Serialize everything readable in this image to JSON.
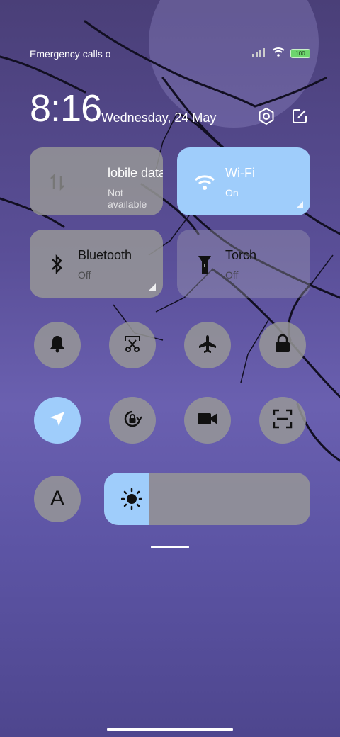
{
  "status": {
    "left_text": "Emergency calls o",
    "battery": "100"
  },
  "header": {
    "time": "8:16",
    "date": "Wednesday, 24 May"
  },
  "tiles": [
    {
      "title": "lobile data",
      "subtitle": "Not available",
      "icon": "data-arrows-icon",
      "state": "unavailable"
    },
    {
      "title": "Wi-Fi",
      "subtitle": "On",
      "icon": "wifi-icon",
      "state": "on"
    },
    {
      "title": "Bluetooth",
      "subtitle": "Off",
      "icon": "bluetooth-icon",
      "state": "off"
    },
    {
      "title": "Torch",
      "subtitle": "Off",
      "icon": "torch-icon",
      "state": "off"
    }
  ],
  "toggles_row1": [
    {
      "icon": "bell-icon",
      "state": "off"
    },
    {
      "icon": "screenshot-icon",
      "state": "off"
    },
    {
      "icon": "airplane-icon",
      "state": "off"
    },
    {
      "icon": "lock-icon",
      "state": "off"
    }
  ],
  "toggles_row2": [
    {
      "icon": "location-icon",
      "state": "on"
    },
    {
      "icon": "rotation-lock-icon",
      "state": "off"
    },
    {
      "icon": "video-camera-icon",
      "state": "off"
    },
    {
      "icon": "scan-icon",
      "state": "off"
    }
  ],
  "font_button": {
    "label": "A"
  },
  "brightness": {
    "level": 0.22
  },
  "colors": {
    "accent": "#9fcdfb",
    "tile": "#969696"
  }
}
